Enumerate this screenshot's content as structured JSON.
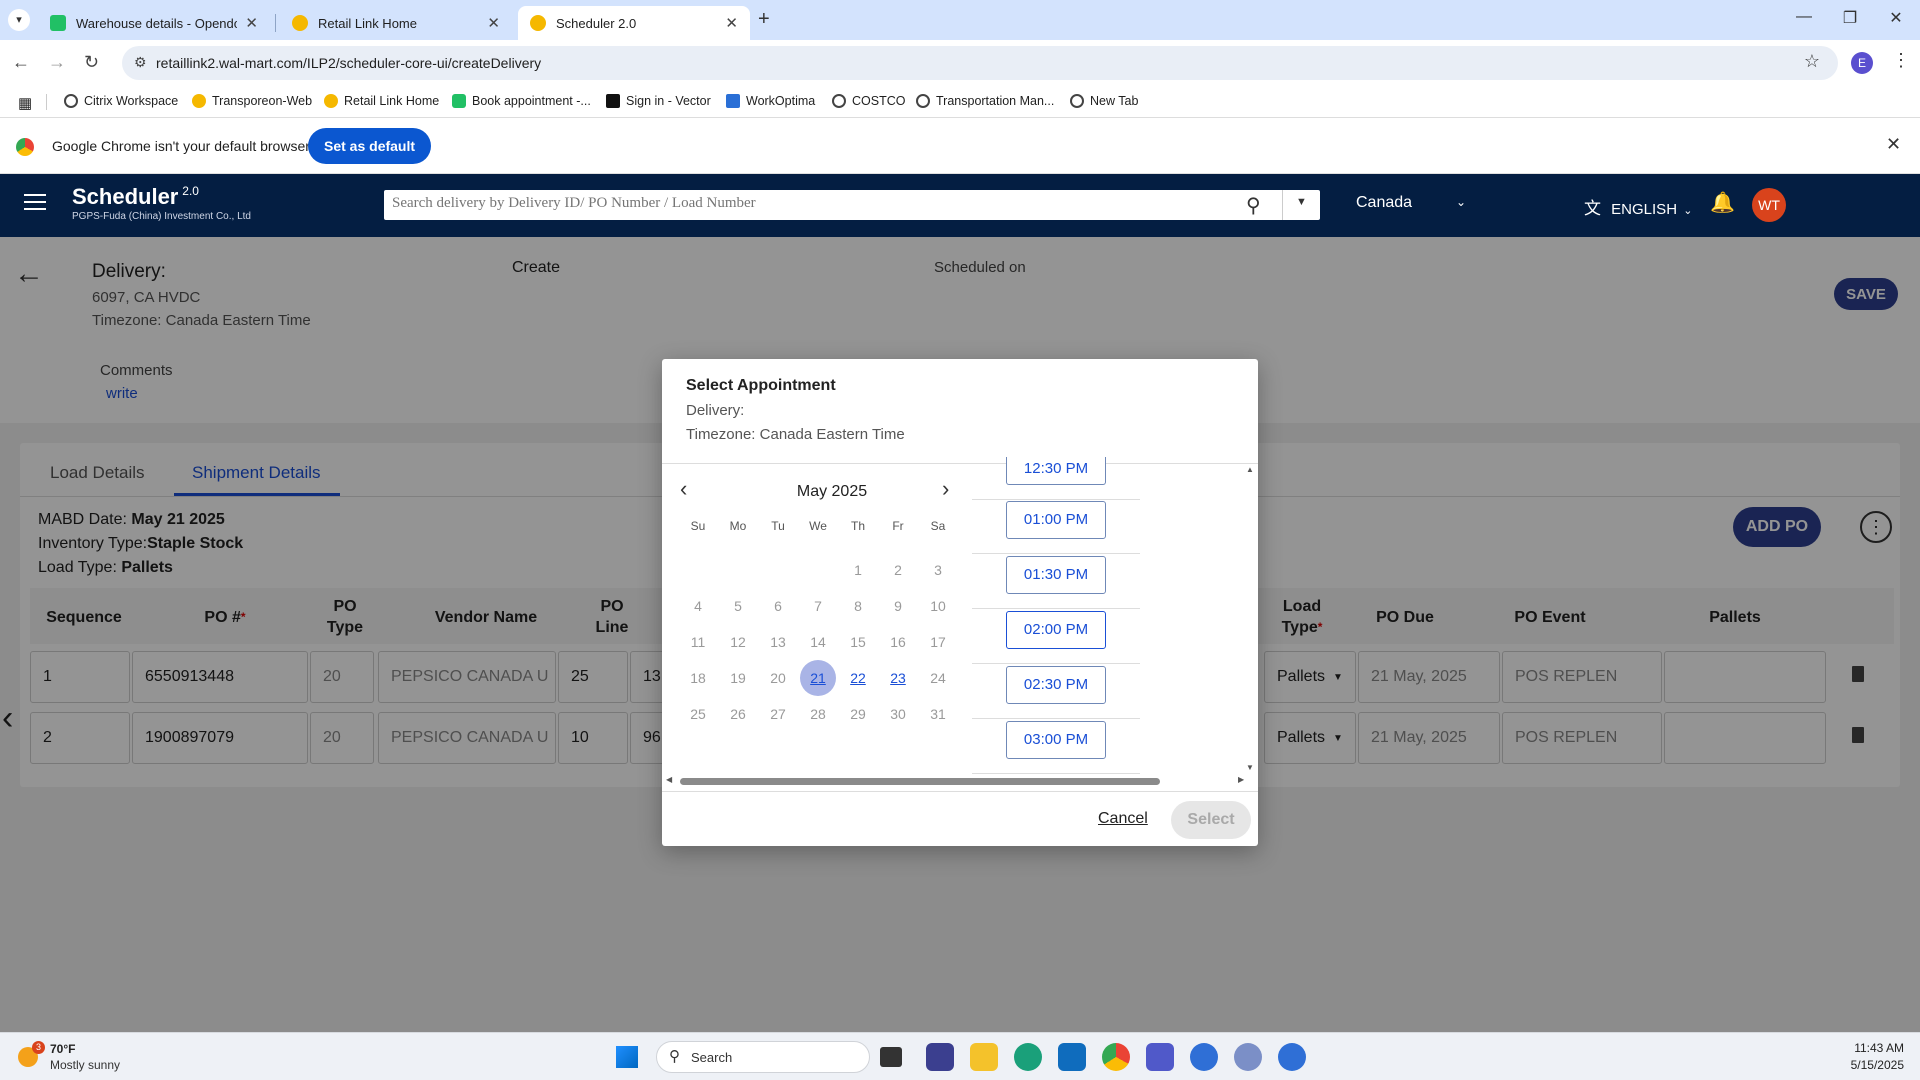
{
  "browser": {
    "tabs": [
      {
        "title": "Warehouse details - Opendock",
        "favicon_color": "#21c065"
      },
      {
        "title": "Retail Link Home",
        "favicon_color": "#f5b800"
      },
      {
        "title": "Scheduler 2.0",
        "favicon_color": "#f5b800"
      }
    ],
    "url": "retaillink2.wal-mart.com/ILP2/scheduler-core-ui/createDelivery",
    "profile_initial": "E",
    "bookmarks": [
      "Citrix Workspace",
      "Transporeon-Web",
      "Retail Link Home",
      "Book appointment -...",
      "Sign in - Vector",
      "WorkOptima",
      "COSTCO",
      "Transportation Man...",
      "New Tab"
    ],
    "infobar": {
      "message": "Google Chrome isn't your default browser",
      "button": "Set as default"
    }
  },
  "app": {
    "logo_title": "Scheduler",
    "logo_version": "2.0",
    "company": "PGPS-Fuda (China) Investment Co., Ltd",
    "search_placeholder": "Search delivery by Delivery ID/ PO Number / Load Number",
    "country": "Canada",
    "language": "ENGLISH",
    "avatar_initials": "WT",
    "colors": {
      "header": "#041e42",
      "accent": "#1a4fd6",
      "button": "#2e3f8f",
      "avatar": "#d9431c"
    }
  },
  "delivery": {
    "label": "Delivery:",
    "location": "6097, CA HVDC",
    "timezone": "Timezone: Canada Eastern Time",
    "create_label": "Create",
    "scheduled_label": "Scheduled on",
    "save_button": "SAVE",
    "comments_label": "Comments",
    "comments_link": "write"
  },
  "tabs": {
    "load": "Load Details",
    "shipment": "Shipment Details"
  },
  "shipment": {
    "mabd_label": "MABD Date:",
    "mabd_value": "May 21 2025",
    "inventory_label": "Inventory Type:",
    "inventory_value": "Staple Stock",
    "load_label": "Load Type:",
    "load_value": "Pallets",
    "add_po_button": "ADD PO",
    "columns": {
      "sequence": "Sequence",
      "po_number": "PO #",
      "po_type_1": "PO",
      "po_type_2": "Type",
      "vendor": "Vendor Name",
      "po_line_1": "PO",
      "po_line_2": "Line",
      "load_type_1": "Load",
      "load_type_2": "Type",
      "po_due": "PO Due",
      "po_event": "PO Event",
      "pallets": "Pallets"
    },
    "rows": [
      {
        "sequence": "1",
        "po": "6550913448",
        "type": "20",
        "vendor": "PEPSICO CANADA U",
        "line": "25",
        "partial": "13",
        "load_type": "Pallets",
        "due": "21 May, 2025",
        "event": "POS REPLEN",
        "pallets": ""
      },
      {
        "sequence": "2",
        "po": "1900897079",
        "type": "20",
        "vendor": "PEPSICO CANADA U",
        "line": "10",
        "partial": "96",
        "load_type": "Pallets",
        "due": "21 May, 2025",
        "event": "POS REPLEN",
        "pallets": ""
      }
    ]
  },
  "dialog": {
    "title": "Select Appointment",
    "delivery_label": "Delivery:",
    "timezone": "Timezone: Canada Eastern Time",
    "month": "May 2025",
    "weekdays": [
      "Su",
      "Mo",
      "Tu",
      "We",
      "Th",
      "Fr",
      "Sa"
    ],
    "weeks": [
      [
        "",
        "",
        "",
        "",
        "1",
        "2",
        "3"
      ],
      [
        "4",
        "5",
        "6",
        "7",
        "8",
        "9",
        "10"
      ],
      [
        "11",
        "12",
        "13",
        "14",
        "15",
        "16",
        "17"
      ],
      [
        "18",
        "19",
        "20",
        "21",
        "22",
        "23",
        "24"
      ],
      [
        "25",
        "26",
        "27",
        "28",
        "29",
        "30",
        "31"
      ]
    ],
    "selected_day": "21",
    "available_days": [
      "21",
      "22",
      "23"
    ],
    "time_slots": [
      "12:30 PM",
      "01:00 PM",
      "01:30 PM",
      "02:00 PM",
      "02:30 PM",
      "03:00 PM"
    ],
    "selected_slot": "02:00 PM",
    "cancel": "Cancel",
    "select": "Select"
  },
  "taskbar": {
    "weather_temp": "70°F",
    "weather_desc": "Mostly sunny",
    "weather_badge": "3",
    "search_placeholder": "Search",
    "time": "11:43 AM",
    "date": "5/15/2025"
  }
}
